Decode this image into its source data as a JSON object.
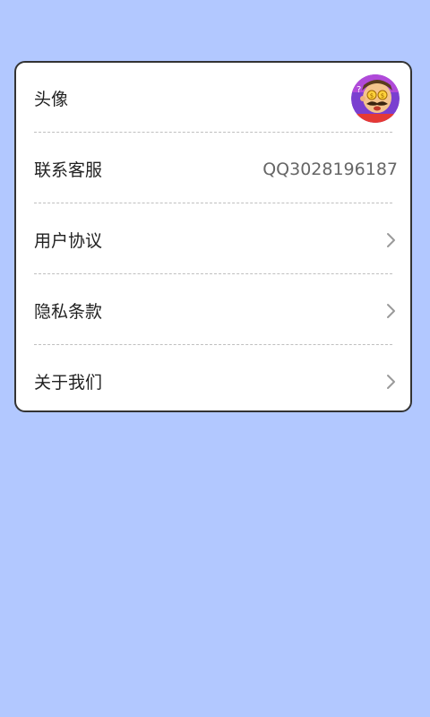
{
  "settings": {
    "avatar_label": "头像",
    "contact_label": "联系客服",
    "contact_value": "QQ3028196187",
    "user_agreement_label": "用户协议",
    "privacy_label": "隐私条款",
    "about_label": "关于我们"
  },
  "colors": {
    "background": "#b2c8ff",
    "card": "#ffffff",
    "border": "#333333"
  },
  "icons": {
    "avatar": "cartoon-character-avatar",
    "chevron": "chevron-right-icon"
  }
}
